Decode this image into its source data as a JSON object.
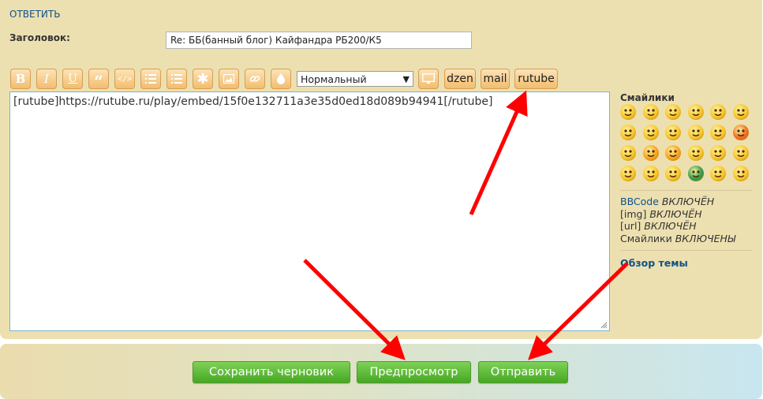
{
  "reply_link": "ОТВЕТИТЬ",
  "subject": {
    "label": "Заголовок:",
    "value": "Re: ББ(банный блог) Кайфандра РБ200/К5"
  },
  "toolbar": {
    "icons": [
      "bold-icon",
      "italic-icon",
      "underline-icon",
      "quote-icon",
      "code-icon",
      "list-icon",
      "ordered-list-icon",
      "list-item-icon",
      "image-icon",
      "link-icon",
      "color-icon"
    ],
    "font_size_selected": "Нормальный",
    "media_icon": "monitor-icon",
    "custom_buttons": [
      "dzen",
      "mail",
      "rutube"
    ]
  },
  "editor": {
    "content": "[rutube]https://rutube.ru/play/embed/15f0e132711a3e35d0ed18d089b94941[/rutube]"
  },
  "smilies": {
    "title": "Смайлики"
  },
  "status": {
    "bbcode": "BBCode",
    "bbcode_state": "ВКЛЮЧЁН",
    "img": "[img]",
    "img_state": "ВКЛЮЧЁН",
    "url": "[url]",
    "url_state": "ВКЛЮЧЁН",
    "smilies": "Смайлики",
    "smilies_state": "ВКЛЮЧЕНЫ"
  },
  "topic_review": "Обзор темы",
  "actions": {
    "save_draft": "Сохранить черновик",
    "preview": "Предпросмотр",
    "submit": "Отправить"
  },
  "colors": {
    "panel": "#ede0b0",
    "button_green": "#5cb832",
    "toolbar_orange": "#f2bd6e",
    "link_blue": "#105289",
    "arrow_red": "#ff0000"
  }
}
